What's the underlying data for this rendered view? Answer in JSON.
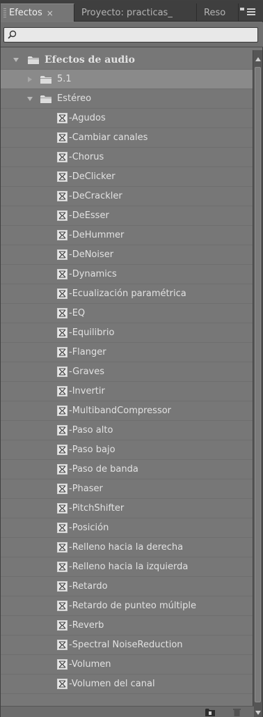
{
  "tabs": [
    {
      "label": "Efectos",
      "close": "×"
    },
    {
      "label": "Proyecto: practicas_"
    },
    {
      "label": "Reso"
    }
  ],
  "search": {
    "value": "",
    "placeholder": ""
  },
  "tree": {
    "root": "Efectos de audio",
    "folder_51": "5.1",
    "folder_stereo": "Estéreo",
    "effects": [
      "Agudos",
      "Cambiar canales",
      "Chorus",
      "DeClicker",
      "DeCrackler",
      "DeEsser",
      "DeHummer",
      "DeNoiser",
      "Dynamics",
      "Ecualización paramétrica",
      "EQ",
      "Equilibrio",
      "Flanger",
      "Graves",
      "Invertir",
      "MultibandCompressor",
      "Paso alto",
      "Paso bajo",
      "Paso de banda",
      "Phaser",
      "PitchShifter",
      "Posición",
      "Relleno hacia la derecha",
      "Relleno hacia la izquierda",
      "Retardo",
      "Retardo de punteo múltiple",
      "Reverb",
      "Spectral NoiseReduction",
      "Volumen",
      "Volumen del canal"
    ]
  },
  "icons": {
    "tab_menu": "panel-menu-icon",
    "search": "search-icon",
    "folder": "folder-icon",
    "effect": "audio-effect-icon",
    "new_bin": "new-bin-icon",
    "delete": "trash-icon"
  },
  "colors": {
    "panel_bg": "#777777",
    "text": "#e2e2e2",
    "tab_bar": "#3f3f3f",
    "highlight_row": "#8a8a8a"
  }
}
